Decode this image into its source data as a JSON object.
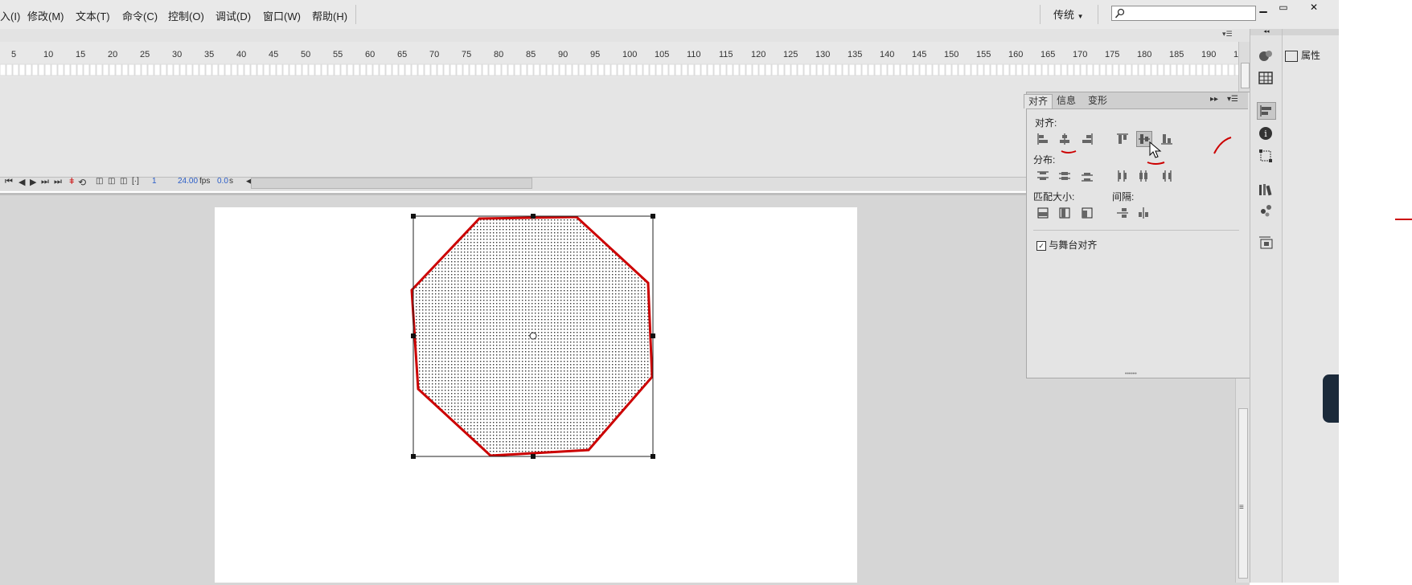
{
  "menu": {
    "items": [
      "入(I)",
      "修改(M)",
      "文本(T)",
      "命令(C)",
      "控制(O)",
      "调试(D)",
      "窗口(W)",
      "帮助(H)"
    ],
    "workspace": "传统",
    "search_placeholder": ""
  },
  "timeline": {
    "ruler_ticks": [
      "5",
      "10",
      "15",
      "20",
      "25",
      "30",
      "35",
      "40",
      "45",
      "50",
      "55",
      "60",
      "65",
      "70",
      "75",
      "80",
      "85",
      "90",
      "95",
      "100",
      "105",
      "110",
      "115",
      "120",
      "125",
      "130",
      "135",
      "140",
      "145",
      "150",
      "155",
      "160",
      "165",
      "170",
      "175",
      "180",
      "185",
      "190",
      "1"
    ],
    "current_frame": "1",
    "fps_value": "24.00",
    "fps_unit": "fps",
    "time_value": "0.0",
    "time_unit": "s"
  },
  "align_panel": {
    "tabs": [
      "对齐",
      "信息",
      "变形"
    ],
    "active_tab": "对齐",
    "sections": {
      "align": "对齐:",
      "distribute": "分布:",
      "match_size": "匹配大小:",
      "spacing": "间隔:"
    },
    "stage_checkbox_label": "与舞台对齐",
    "stage_checkbox_checked": true
  },
  "properties_tab": {
    "label": "属性"
  },
  "colors": {
    "annotation_red": "#cc0000",
    "shape_outline": "#cc0000",
    "stage": "#ffffff",
    "pasteboard": "#d6d6d6"
  }
}
